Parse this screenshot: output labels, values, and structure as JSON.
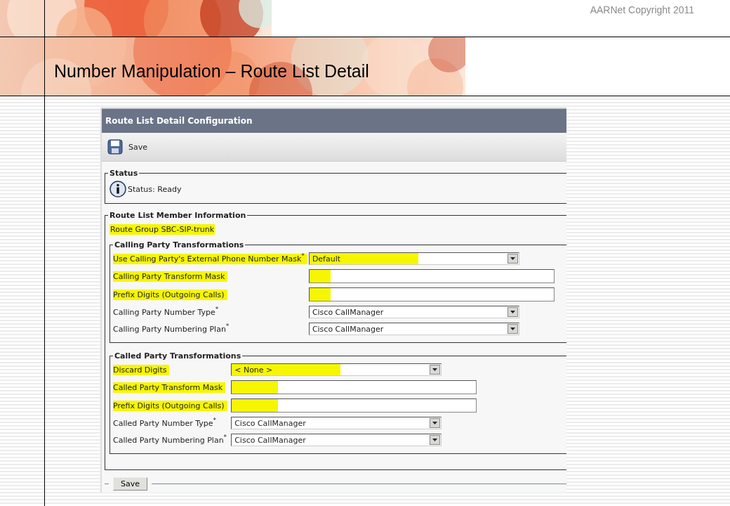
{
  "slide": {
    "copyright": "AARNet Copyright 2011",
    "title": "Number Manipulation – Route List Detail"
  },
  "panel": {
    "title": "Route List Detail Configuration",
    "toolbar_button": "Save",
    "status": {
      "legend": "Status",
      "message": "Status: Ready"
    },
    "member": {
      "legend": "Route List Member Information",
      "route_group": {
        "text": "Route Group SBC-SIP-trunk",
        "highlighted": true
      },
      "sections": [
        {
          "legend": "Calling Party Transformations",
          "fields": [
            {
              "kind": "select",
              "label": "Use Calling Party's External Phone Number Mask$^{*}$",
              "value": "Default",
              "highlighted": true
            },
            {
              "kind": "text",
              "label": "Calling Party Transform Mask",
              "highlighted": true
            },
            {
              "kind": "text",
              "label": "Prefix Digits (Outgoing Calls)",
              "highlighted": true
            },
            {
              "kind": "select",
              "label": "Calling Party Number Type$^{*}$",
              "value": "Cisco CallManager",
              "highlighted": false
            },
            {
              "kind": "select",
              "label": "Calling Party Numbering Plan$^{*}$",
              "value": "Cisco CallManager",
              "highlighted": false
            }
          ]
        },
        {
          "legend": "Called Party Transformations",
          "fields": [
            {
              "kind": "select",
              "label": "Discard Digits",
              "value": "< None >",
              "highlighted": true
            },
            {
              "kind": "text",
              "label": "Called Party Transform Mask",
              "highlighted": true
            },
            {
              "kind": "text",
              "label": "Prefix Digits (Outgoing Calls)",
              "highlighted": true
            },
            {
              "kind": "select",
              "label": "Called Party Number Type$^{*}$",
              "value": "Cisco CallManager",
              "highlighted": false
            },
            {
              "kind": "select",
              "label": "Called Party Numbering Plan$^{*}$",
              "value": "Cisco CallManager",
              "highlighted": false
            }
          ]
        }
      ]
    },
    "footer_button": "Save"
  }
}
